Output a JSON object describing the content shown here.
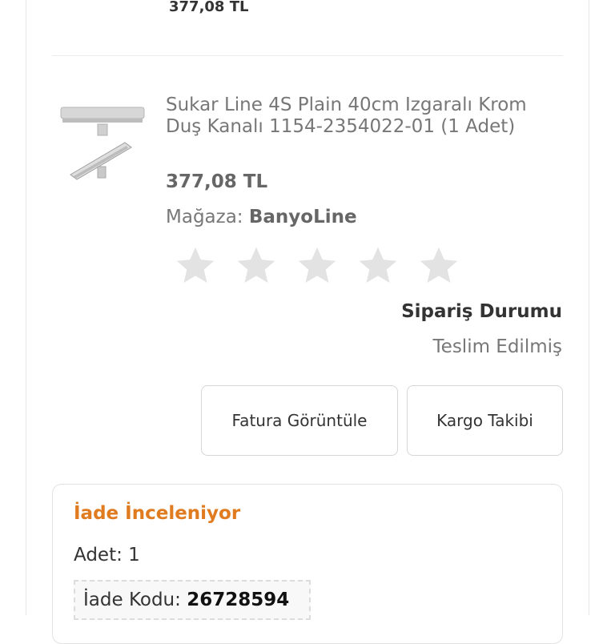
{
  "previous_item": {
    "price": "377,08 TL"
  },
  "item": {
    "title": "Sukar Line 4S Plain 40cm Izgaralı Krom Duş Kanalı 1154-2354022-01 (1 Adet)",
    "price": "377,08 TL",
    "store_label": "Mağaza:",
    "store_name": "BanyoLine",
    "rating": {
      "value": 0,
      "max": 5
    }
  },
  "order_status": {
    "label": "Sipariş Durumu",
    "value": "Teslim Edilmiş"
  },
  "actions": {
    "invoice": "Fatura Görüntüle",
    "cargo": "Kargo Takibi"
  },
  "return_info": {
    "status": "İade İnceleniyor",
    "quantity_label": "Adet:",
    "quantity": "1",
    "code_label": "İade Kodu:",
    "code": "26728594"
  },
  "colors": {
    "accent": "#e07b1f",
    "star": "#e3e3e3"
  }
}
